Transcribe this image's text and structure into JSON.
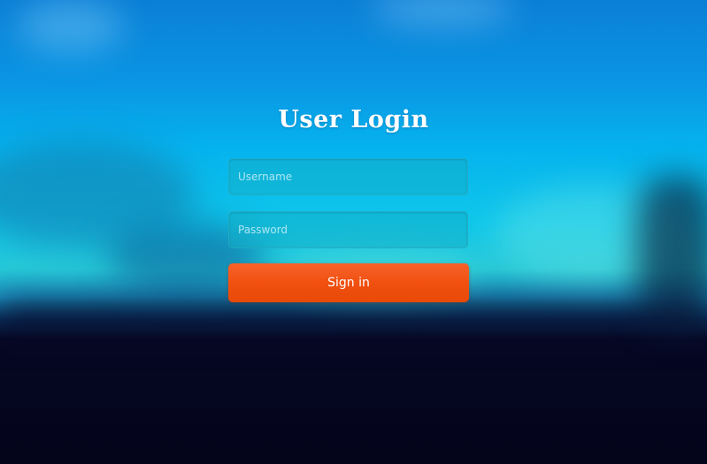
{
  "login": {
    "title": "User Login",
    "username_placeholder": "Username",
    "password_placeholder": "Password",
    "signin_label": "Sign in"
  },
  "colors": {
    "button": "#f0520f",
    "input_fill": "#14afc8",
    "title_text": "#ffffff"
  }
}
